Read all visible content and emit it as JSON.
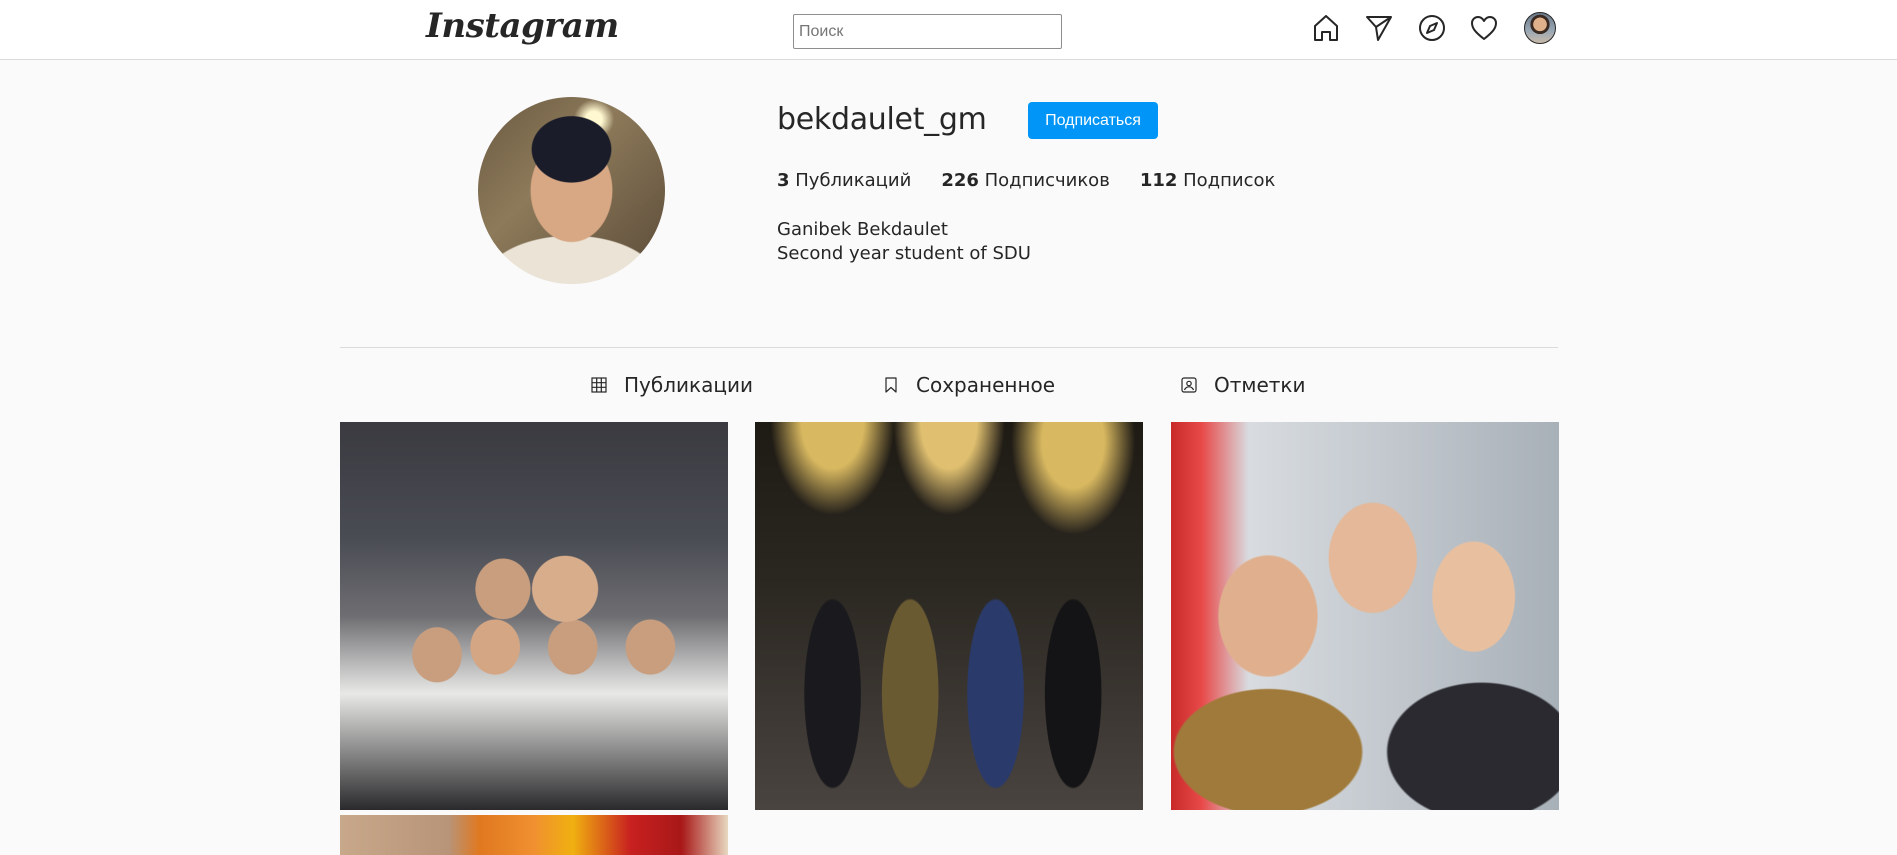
{
  "topbar": {
    "logo": "Instagram",
    "search_placeholder": "Поиск",
    "icons": [
      "home-icon",
      "direct-message-icon",
      "explore-icon",
      "heart-icon",
      "profile-avatar"
    ]
  },
  "profile": {
    "username": "bekdaulet_gm",
    "follow_label": "Подписаться",
    "stats": [
      {
        "count": "3",
        "label": "Публикаций"
      },
      {
        "count": "226",
        "label": "Подписчиков"
      },
      {
        "count": "112",
        "label": "Подписок"
      }
    ],
    "bio": [
      "Ganibek Bekdaulet",
      "Second year student of SDU"
    ]
  },
  "tabs": [
    {
      "label": "Публикации",
      "icon": "grid-icon"
    },
    {
      "label": "Сохраненное",
      "icon": "bookmark-icon"
    },
    {
      "label": "Отметки",
      "icon": "tagged-icon"
    }
  ],
  "colors": {
    "accent": "#0095f6",
    "background": "#fafafa",
    "border": "#dbdbdb"
  }
}
